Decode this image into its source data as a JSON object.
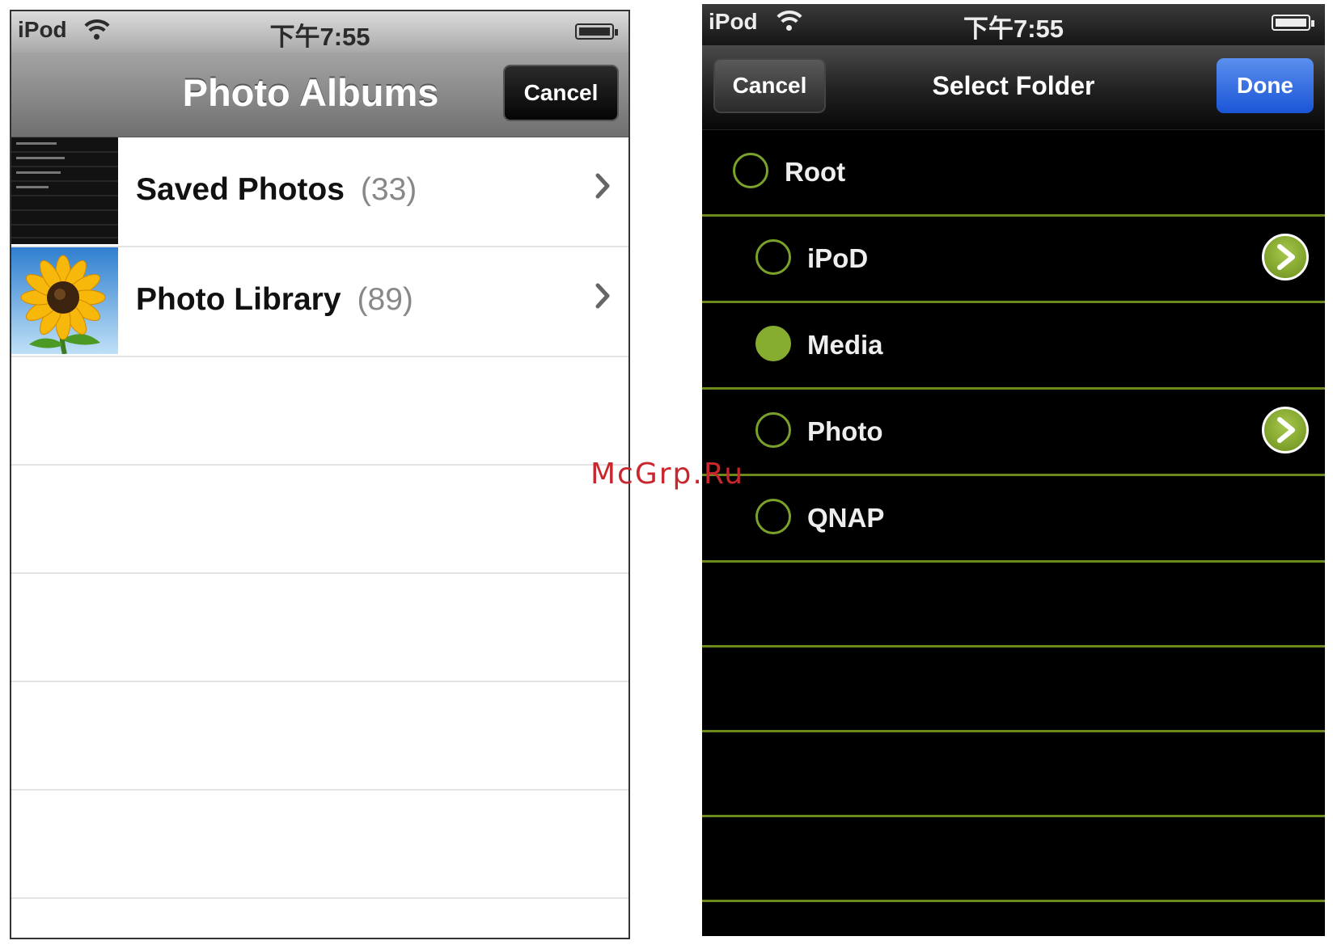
{
  "left_screen": {
    "status_bar": {
      "carrier": "iPod",
      "time": "下午7:55"
    },
    "nav": {
      "title": "Photo Albums",
      "cancel_label": "Cancel"
    },
    "albums": [
      {
        "name": "Saved Photos",
        "count": "(33)"
      },
      {
        "name": "Photo Library",
        "count": "(89)"
      }
    ]
  },
  "right_screen": {
    "status_bar": {
      "carrier": "iPod",
      "time": "下午7:55"
    },
    "nav": {
      "cancel_label": "Cancel",
      "title": "Select Folder",
      "done_label": "Done"
    },
    "folders": [
      {
        "name": "Root",
        "selected": false,
        "has_children": false
      },
      {
        "name": "iPoD",
        "selected": false,
        "has_children": true
      },
      {
        "name": "Media",
        "selected": true,
        "has_children": false
      },
      {
        "name": "Photo",
        "selected": false,
        "has_children": true
      },
      {
        "name": "QNAP",
        "selected": false,
        "has_children": false
      }
    ]
  },
  "watermark": "McGrp.Ru",
  "colors": {
    "accent_green": "#86ad2f",
    "done_blue": "#1a55d6",
    "divider_green": "#6c8a1c"
  },
  "icons": [
    "wifi-icon",
    "battery-icon",
    "chevron-right-icon",
    "sunflower-thumbnail",
    "radio-button-icon",
    "disclosure-arrow-icon"
  ]
}
